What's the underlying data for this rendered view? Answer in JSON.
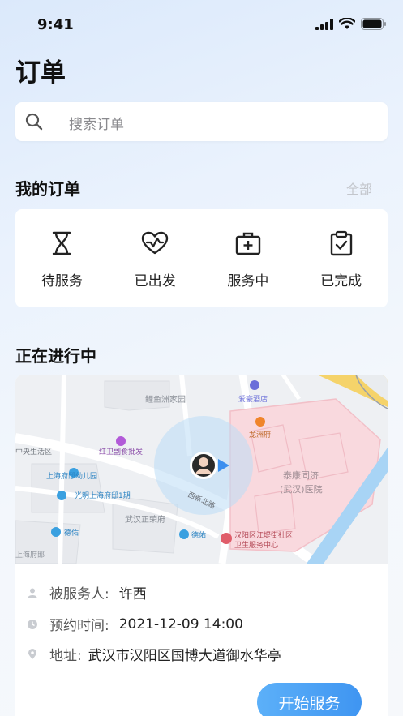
{
  "status_bar": {
    "time": "9:41"
  },
  "header": {
    "title": "订单"
  },
  "search": {
    "placeholder": "搜索订单"
  },
  "my_orders": {
    "title": "我的订单",
    "all_label": "全部",
    "items": [
      {
        "label": "待服务",
        "icon": "hourglass-icon"
      },
      {
        "label": "已出发",
        "icon": "heart-pulse-icon"
      },
      {
        "label": "服务中",
        "icon": "medical-kit-icon"
      },
      {
        "label": "已完成",
        "icon": "clipboard-check-icon"
      }
    ]
  },
  "in_progress": {
    "title": "正在进行中",
    "map_labels": {
      "l1": "鲤鱼洲家园",
      "l2": "爱豪酒店",
      "l3": "龙洲府",
      "l4": "中央生活区",
      "l5": "红卫副食批发",
      "l6": "上海府邸幼儿园",
      "l7": "光明上海府邸1期",
      "l8": "泰康同济",
      "l9": "(武汉)医院",
      "l10": "西新北路",
      "l11": "武汉正荣府",
      "l12": "德佑",
      "l13": "德佑",
      "l14": "汉阳区江堤街社区",
      "l15": "卫生服务中心",
      "l16": "上海府邸"
    },
    "served_label": "被服务人:",
    "served_value": "许西",
    "time_label": "预约时间:",
    "time_value": "2021-12-09 14:00",
    "address_label": "地址:",
    "address_value": "武汉市汉阳区国博大道御水华亭",
    "start_button": "开始服务"
  },
  "colors": {
    "accent": "#3f95f1",
    "hospital_area": "#f9d9de",
    "river": "#a8d4f5"
  }
}
